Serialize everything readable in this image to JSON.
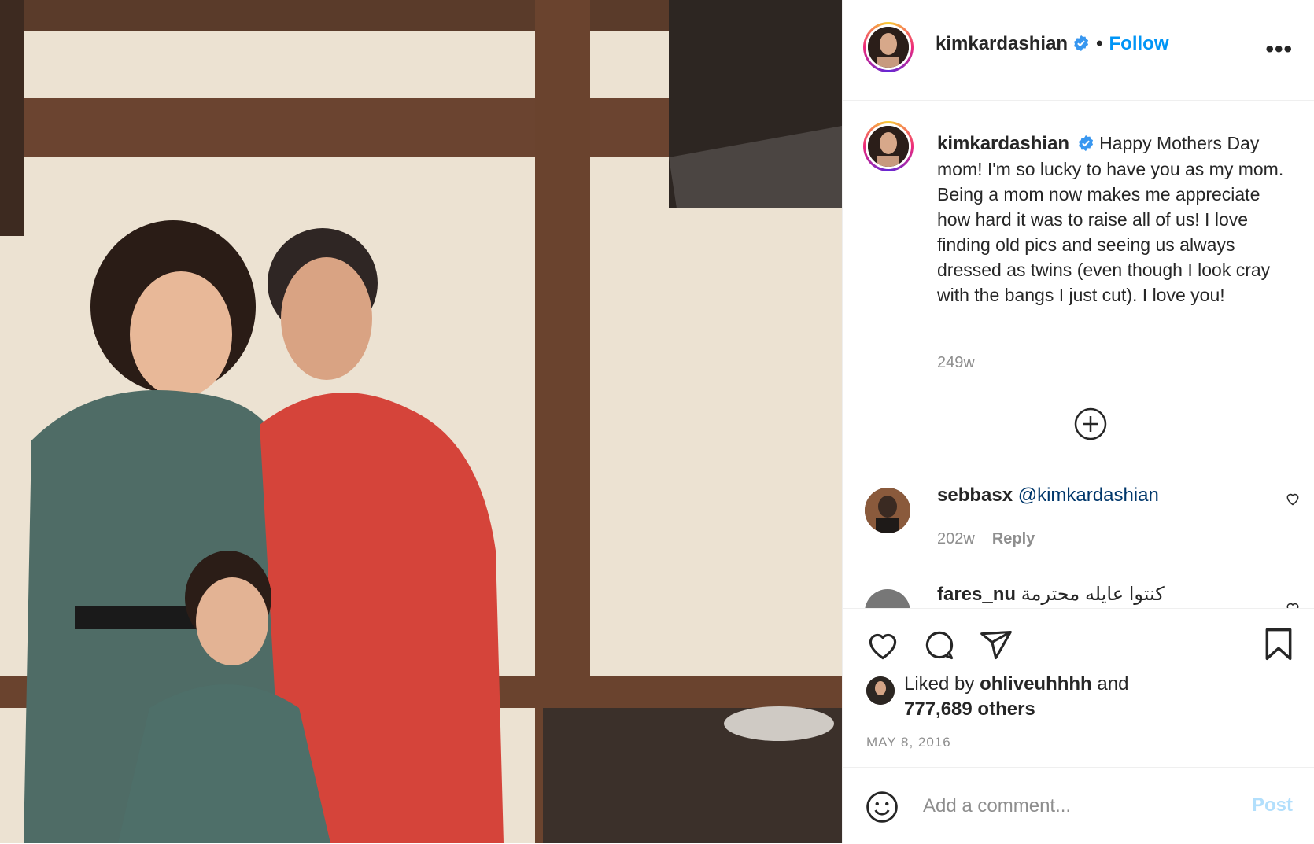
{
  "post": {
    "image_alt": "Family photo",
    "colors": {
      "accent": "#0095f6",
      "muted": "#8e8e8e",
      "text": "#262626",
      "post_disabled": "#b2dffc"
    }
  },
  "header": {
    "username": "kimkardashian",
    "dot": "•",
    "follow_label": "Follow",
    "more_icon": "more-horizontal-icon",
    "more_label": "•••"
  },
  "caption": {
    "username": "kimkardashian",
    "text": "Happy Mothers Day mom! I'm so lucky to have you as my mom. Being a mom now makes me appreciate how hard it was to raise all of us! I love finding old pics and seeing us always dressed as twins (even though I look cray with the bangs I just cut). I love you!",
    "time": "249w"
  },
  "comments": [
    {
      "username": "sebbasx",
      "text": "@kimkardashian",
      "time": "202w",
      "reply_label": "Reply"
    },
    {
      "username": "fares_nu",
      "text": "كنتوا عايله محترمة",
      "time": "",
      "reply_label": ""
    }
  ],
  "actions": {
    "icons": [
      "heart-icon",
      "comment-icon",
      "share-icon",
      "bookmark-icon"
    ],
    "liked_prefix": "Liked by ",
    "liked_user": "ohliveuhhhh",
    "liked_and": " and",
    "liked_count": "777,689 others",
    "date": "MAY 8, 2016"
  },
  "add_comment": {
    "placeholder": "Add a comment...",
    "post_label": "Post",
    "emoji_icon": "emoji-icon"
  }
}
